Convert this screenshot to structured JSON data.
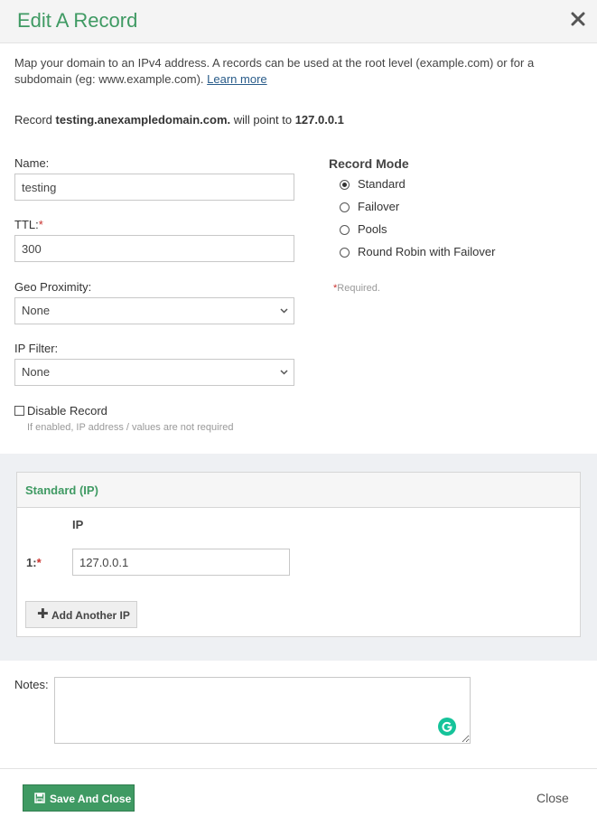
{
  "modal": {
    "title": "Edit A Record",
    "intro_text": "Map your domain to an IPv4 address. A records can be used at the root level (example.com) or for a subdomain (eg: www.example.com). ",
    "learn_more": "Learn more",
    "pointer": {
      "prefix": "Record ",
      "host": "testing.anexampledomain.com.",
      "middle": " will point to ",
      "target": "127.0.0.1"
    }
  },
  "form": {
    "name_label": "Name:",
    "name_value": "testing",
    "ttl_label": "TTL:",
    "ttl_value": "300",
    "required_mark": "*",
    "geo_label": "Geo Proximity:",
    "geo_value": "None",
    "ipfilter_label": "IP Filter:",
    "ipfilter_value": "None",
    "disable_label": "Disable Record",
    "disable_checked": false,
    "disable_hint": "If enabled, IP address / values are not required"
  },
  "record_mode": {
    "title": "Record Mode",
    "options": [
      {
        "label": "Standard",
        "checked": true
      },
      {
        "label": "Failover",
        "checked": false
      },
      {
        "label": "Pools",
        "checked": false
      },
      {
        "label": "Round Robin with Failover",
        "checked": false
      }
    ],
    "required_note_star": "*",
    "required_note": "Required."
  },
  "standard_ip": {
    "title": "Standard (IP)",
    "column_header": "IP",
    "rows": [
      {
        "label": "1:",
        "value": "127.0.0.1"
      }
    ],
    "add_button": "Add Another IP"
  },
  "notes": {
    "label": "Notes:",
    "value": ""
  },
  "footer": {
    "save_button": "Save And Close",
    "close_link": "Close"
  },
  "colors": {
    "accent": "#3f9a63",
    "required": "#c9302c",
    "band": "#eef0f3"
  }
}
